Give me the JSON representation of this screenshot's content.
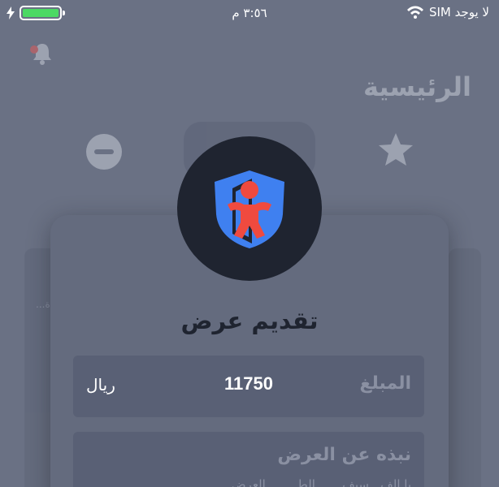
{
  "status_bar": {
    "carrier": "لا يوجد SIM",
    "time": "٣:٥٦ م",
    "battery_level": 1.0,
    "colors": {
      "battery": "#4cd964"
    }
  },
  "background": {
    "page_title": "الرئيسية",
    "left_card_text": "...ة",
    "icons": [
      "bell-icon",
      "minus-circle-icon",
      "star-icon"
    ]
  },
  "modal": {
    "title": "تقديم عرض",
    "icon": "child-shield-icon",
    "amount": {
      "label": "المبلغ",
      "value": "11750",
      "currency": "ريال"
    },
    "about": {
      "title": "نبذه عن العرض",
      "text": "يا الف...سيف... ...الط... ... العرض"
    },
    "colors": {
      "badge_bg": "#1f2430",
      "shield": "#3f80f0",
      "figure": "#f04a3f"
    }
  }
}
